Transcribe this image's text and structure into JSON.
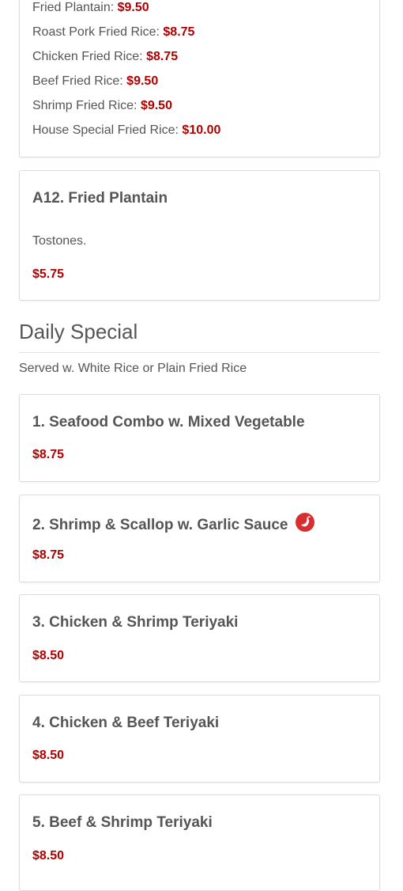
{
  "fried_rice_card": {
    "lines": [
      {
        "label": "Fried Plantain:",
        "price": "$9.50"
      },
      {
        "label": "Roast Pork Fried Rice:",
        "price": "$8.75"
      },
      {
        "label": "Chicken Fried Rice:",
        "price": "$8.75"
      },
      {
        "label": "Beef Fried Rice:",
        "price": "$9.50"
      },
      {
        "label": "Shrimp Fried Rice:",
        "price": "$9.50"
      },
      {
        "label": "House Special Fried Rice:",
        "price": "$10.00"
      }
    ]
  },
  "a12": {
    "title": "A12. Fried Plantain",
    "description": "Tostones.",
    "price": "$5.75"
  },
  "daily_special": {
    "title": "Daily Special",
    "subtitle": "Served w. White Rice or Plain Fried Rice",
    "items": [
      {
        "title": "1. Seafood Combo w. Mixed Vegetable",
        "price": "$8.75",
        "spicy": false
      },
      {
        "title": "2. Shrimp & Scallop w. Garlic Sauce",
        "price": "$8.75",
        "spicy": true,
        "icon": "chili-pepper-icon"
      },
      {
        "title": "3. Chicken & Shrimp Teriyaki",
        "price": "$8.50",
        "spicy": false
      },
      {
        "title": "4. Chicken & Beef Teriyaki",
        "price": "$8.50",
        "spicy": false
      },
      {
        "title": "5. Beef & Shrimp Teriyaki",
        "price": "$8.50",
        "spicy": false
      }
    ]
  },
  "colors": {
    "price": "#b00000",
    "text": "#555555",
    "spicy_badge": "#d72f2f"
  }
}
